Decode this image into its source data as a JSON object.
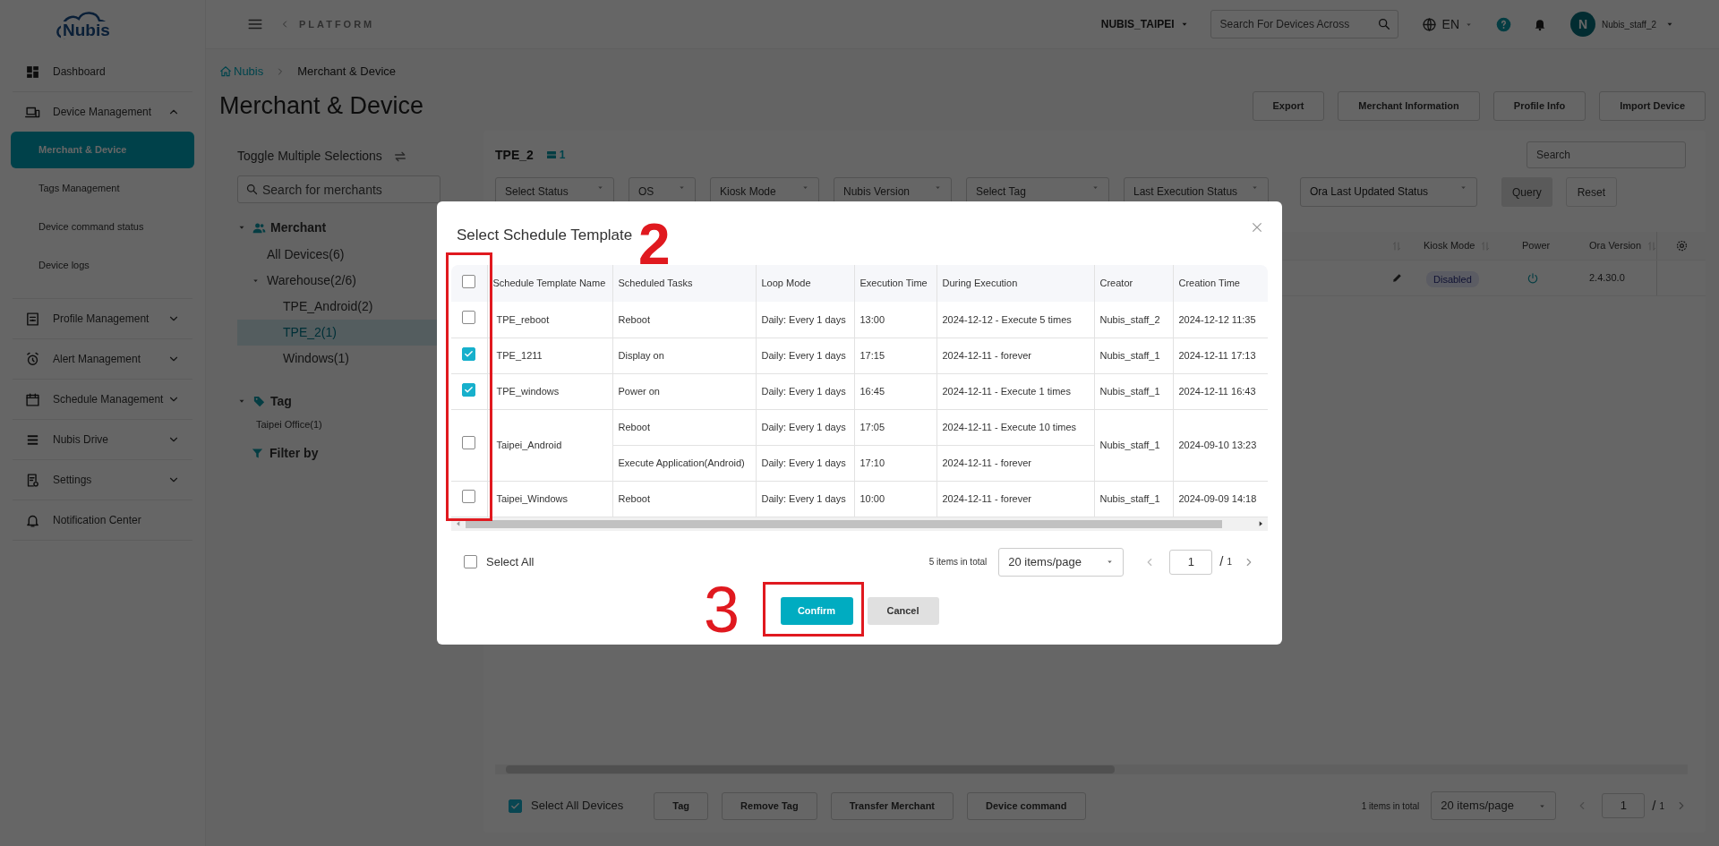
{
  "sidebar": {
    "logo": "Nubis",
    "items": [
      {
        "kind": "link",
        "label": "Dashboard"
      },
      {
        "kind": "group",
        "label": "Device Management",
        "expanded": true,
        "children": [
          {
            "label": "Merchant & Device",
            "selected": true
          },
          {
            "label": "Tags Management",
            "selected": false
          },
          {
            "label": "Device command status",
            "selected": false
          },
          {
            "label": "Device logs",
            "selected": false
          }
        ]
      },
      {
        "kind": "group",
        "label": "Profile Management",
        "expanded": false
      },
      {
        "kind": "group",
        "label": "Alert Management",
        "expanded": false
      },
      {
        "kind": "group",
        "label": "Schedule Management",
        "expanded": false
      },
      {
        "kind": "group",
        "label": "Nubis Drive",
        "expanded": false
      },
      {
        "kind": "group",
        "label": "Settings",
        "expanded": false
      },
      {
        "kind": "link",
        "label": "Notification Center"
      }
    ]
  },
  "header": {
    "back_label": "PLATFORM",
    "merchant": "NUBIS_TAIPEI",
    "search": {
      "placeholder": "Search For Devices Across"
    },
    "language": "EN",
    "user": {
      "initial": "N",
      "name": "Nubis_staff_2"
    }
  },
  "breadcrumb": [
    "Nubis",
    "Merchant & Device"
  ],
  "page_title": "Merchant & Device",
  "actions": [
    "Export",
    "Merchant Information",
    "Profile Info",
    "Import Device"
  ],
  "tree_panel": {
    "toggle_label": "Toggle Multiple Selections",
    "search": {
      "placeholder": "Search for merchants"
    },
    "merchant": {
      "title": "Merchant",
      "expanded": true,
      "items": [
        {
          "label": "All Devices(6)",
          "selected": false
        },
        {
          "label": "Warehouse(2/6)",
          "selected": false,
          "expanded": true,
          "children": [
            {
              "label": "TPE_Android(2)",
              "selected": false
            },
            {
              "label": "TPE_2(1)",
              "selected": true
            },
            {
              "label": "Windows(1)",
              "selected": false
            }
          ]
        }
      ]
    },
    "tag": {
      "title": "Tag",
      "expanded": true,
      "items": [
        {
          "label": "Taipei Office(1)",
          "selected": false
        }
      ]
    },
    "filter_label": "Filter by"
  },
  "device_panel": {
    "title": "TPE_2",
    "device_count": "1",
    "search": {
      "placeholder": "Search"
    },
    "filters": [
      "Select Status",
      "OS",
      "Kiosk Mode",
      "Nubis Version",
      "Select Tag",
      "Last Execution Status",
      "Ora Last Updated Status"
    ],
    "buttons": [
      "Query",
      "Reset"
    ],
    "columns": [
      "Kiosk Mode",
      "Power",
      "Ora Version"
    ],
    "rows": [
      {
        "kiosk_mode": "Disabled",
        "ora_version": "2.4.30.0"
      }
    ],
    "select_all": {
      "label": "Select All Devices",
      "checked": true
    },
    "bulk_actions": [
      "Tag",
      "Remove Tag",
      "Transfer Merchant",
      "Device command"
    ],
    "pagination": {
      "total": "1 items in total",
      "page_size": "20 items/page",
      "page": "1",
      "separator": "/",
      "page_count": "1"
    }
  },
  "modal": {
    "title": "Select Schedule Template",
    "header_checked": false,
    "columns": [
      "Schedule Template Name",
      "Scheduled Tasks",
      "Loop Mode",
      "Execution Time",
      "During Execution",
      "Creator",
      "Creation Time"
    ],
    "rows": [
      {
        "selected": false,
        "name": "TPE_reboot",
        "tasks": [
          {
            "task": "Reboot",
            "loop_mode": "Daily: Every 1 days",
            "execution_time": "13:00",
            "during_execution": "2024-12-12 - Execute 5 times"
          }
        ],
        "creator": "Nubis_staff_2",
        "creation_time": "2024-12-12 11:35"
      },
      {
        "selected": true,
        "name": "TPE_1211",
        "tasks": [
          {
            "task": "Display on",
            "loop_mode": "Daily: Every 1 days",
            "execution_time": "17:15",
            "during_execution": "2024-12-11 - forever"
          }
        ],
        "creator": "Nubis_staff_1",
        "creation_time": "2024-12-11 17:13"
      },
      {
        "selected": true,
        "name": "TPE_windows",
        "tasks": [
          {
            "task": "Power on",
            "loop_mode": "Daily: Every 1 days",
            "execution_time": "16:45",
            "during_execution": "2024-12-11 - Execute 1 times"
          }
        ],
        "creator": "Nubis_staff_1",
        "creation_time": "2024-12-11 16:43"
      },
      {
        "selected": false,
        "name": "Taipei_Android",
        "tasks": [
          {
            "task": "Reboot",
            "loop_mode": "Daily: Every 1 days",
            "execution_time": "17:05",
            "during_execution": "2024-12-11 - Execute 10 times"
          },
          {
            "task": "Execute Application(Android)",
            "loop_mode": "Daily: Every 1 days",
            "execution_time": "17:10",
            "during_execution": "2024-12-11 - forever"
          }
        ],
        "creator": "Nubis_staff_1",
        "creation_time": "2024-09-10 13:23"
      },
      {
        "selected": false,
        "name": "Taipei_Windows",
        "tasks": [
          {
            "task": "Reboot",
            "loop_mode": "Daily: Every 1 days",
            "execution_time": "10:00",
            "during_execution": "2024-12-11 - forever"
          }
        ],
        "creator": "Nubis_staff_1",
        "creation_time": "2024-09-09 14:18"
      }
    ],
    "select_all": {
      "label": "Select All",
      "checked": false
    },
    "pagination": {
      "total": "5 items in total",
      "page_size": "20 items/page",
      "page": "1",
      "separator": "/",
      "page_count": "1"
    },
    "confirm": "Confirm",
    "cancel": "Cancel"
  },
  "annotations": [
    {
      "kind": "checkbox_column",
      "label": "2"
    },
    {
      "kind": "confirm_button",
      "label": "3"
    }
  ]
}
